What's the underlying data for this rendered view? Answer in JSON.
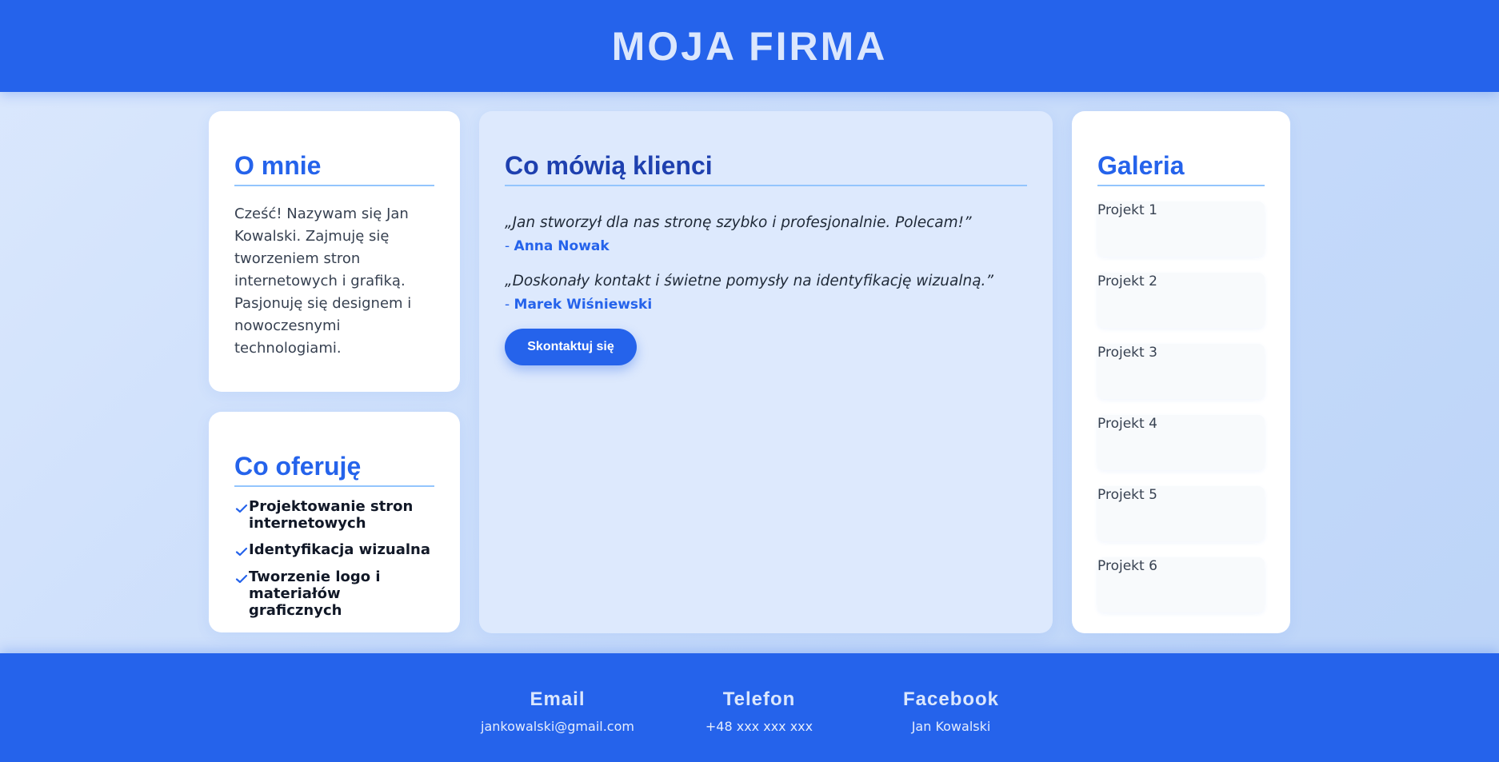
{
  "header": {
    "logo": "MOJA FIRMA"
  },
  "about": {
    "title": "O mnie",
    "text": "Cześć! Nazywam się Jan Kowalski. Zajmuję się tworzeniem stron internetowych i grafiką. Pasjonuję się designem i nowoczesnymi technologiami."
  },
  "offer": {
    "title": "Co oferuję",
    "items": [
      {
        "label": "Projektowanie stron internetowych",
        "icon": "check-icon"
      },
      {
        "label": "Identyfikacja wizualna",
        "icon": "check-icon"
      },
      {
        "label": "Tworzenie logo i materiałów graficznych",
        "icon": "check-icon"
      }
    ]
  },
  "testimonials": {
    "title": "Co mówią klienci",
    "items": [
      {
        "quote": "„Jan stworzył dla nas stronę szybko i profesjonalnie. Polecam!”",
        "dash": "- ",
        "author": "Anna Nowak"
      },
      {
        "quote": "„Doskonały kontakt i świetne pomysły na identyfikację wizualną.”",
        "dash": "- ",
        "author": "Marek Wiśniewski"
      }
    ],
    "button_label": "Skontaktuj się"
  },
  "gallery": {
    "title": "Galeria",
    "items": [
      {
        "alt": "Projekt 1"
      },
      {
        "alt": "Projekt 2"
      },
      {
        "alt": "Projekt 3"
      },
      {
        "alt": "Projekt 4"
      },
      {
        "alt": "Projekt 5"
      },
      {
        "alt": "Projekt 6"
      }
    ]
  },
  "footer": {
    "email": {
      "label": "Email",
      "value": "jankowalski@gmail.com"
    },
    "phone": {
      "label": "Telefon",
      "value": "+48 xxx xxx xxx"
    },
    "facebook": {
      "label": "Facebook",
      "value": "Jan Kowalski"
    }
  },
  "colors": {
    "primary": "#2563eb",
    "accent_light": "#93c5fd",
    "background": "#dbe8fd"
  }
}
